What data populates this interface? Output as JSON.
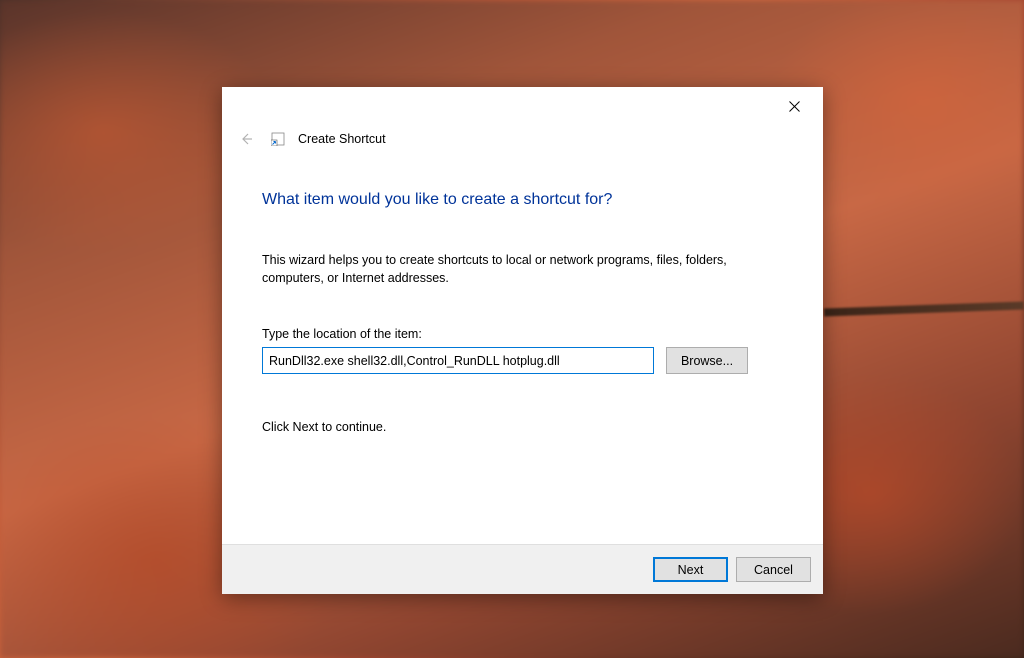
{
  "dialog": {
    "title": "Create Shortcut",
    "heading": "What item would you like to create a shortcut for?",
    "description": "This wizard helps you to create shortcuts to local or network programs, files, folders, computers, or Internet addresses.",
    "input_label": "Type the location of the item:",
    "input_value": "RunDll32.exe shell32.dll,Control_RunDLL hotplug.dll",
    "browse_label": "Browse...",
    "continue_text": "Click Next to continue.",
    "next_label": "Next",
    "cancel_label": "Cancel"
  }
}
